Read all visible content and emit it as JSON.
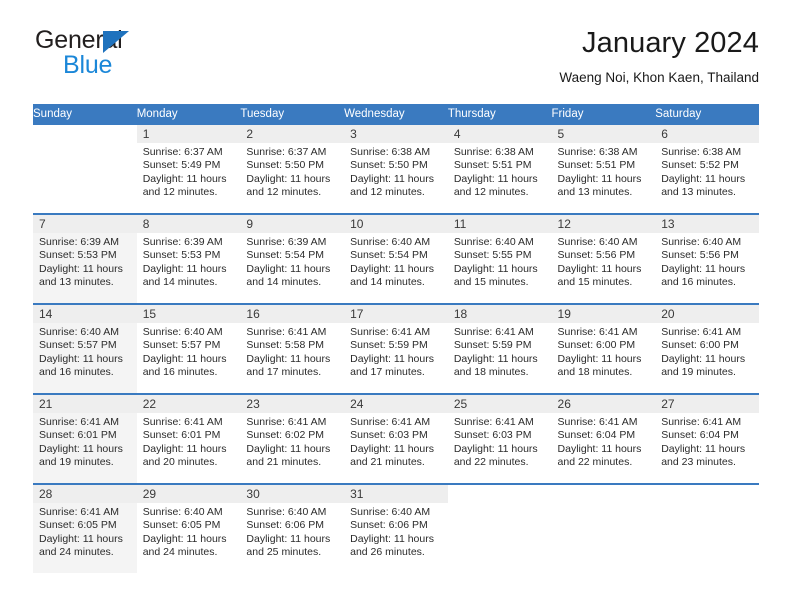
{
  "brand": {
    "name_part1": "General",
    "name_part2": "Blue",
    "accent_color": "#1b87d8",
    "triangle_color": "#1f72bd"
  },
  "header": {
    "title": "January 2024",
    "subtitle": "Waeng Noi, Khon Kaen, Thailand"
  },
  "calendar": {
    "header_bg": "#3a7ac0",
    "header_text_color": "#ffffff",
    "weekday_headers": [
      "Sunday",
      "Monday",
      "Tuesday",
      "Wednesday",
      "Thursday",
      "Friday",
      "Saturday"
    ],
    "weeks": [
      [
        {
          "date": "",
          "sunrise": "",
          "sunset": "",
          "daylight_line1": "",
          "daylight_line2": ""
        },
        {
          "date": "1",
          "sunrise": "Sunrise: 6:37 AM",
          "sunset": "Sunset: 5:49 PM",
          "daylight_line1": "Daylight: 11 hours",
          "daylight_line2": "and 12 minutes."
        },
        {
          "date": "2",
          "sunrise": "Sunrise: 6:37 AM",
          "sunset": "Sunset: 5:50 PM",
          "daylight_line1": "Daylight: 11 hours",
          "daylight_line2": "and 12 minutes."
        },
        {
          "date": "3",
          "sunrise": "Sunrise: 6:38 AM",
          "sunset": "Sunset: 5:50 PM",
          "daylight_line1": "Daylight: 11 hours",
          "daylight_line2": "and 12 minutes."
        },
        {
          "date": "4",
          "sunrise": "Sunrise: 6:38 AM",
          "sunset": "Sunset: 5:51 PM",
          "daylight_line1": "Daylight: 11 hours",
          "daylight_line2": "and 12 minutes."
        },
        {
          "date": "5",
          "sunrise": "Sunrise: 6:38 AM",
          "sunset": "Sunset: 5:51 PM",
          "daylight_line1": "Daylight: 11 hours",
          "daylight_line2": "and 13 minutes."
        },
        {
          "date": "6",
          "sunrise": "Sunrise: 6:38 AM",
          "sunset": "Sunset: 5:52 PM",
          "daylight_line1": "Daylight: 11 hours",
          "daylight_line2": "and 13 minutes."
        }
      ],
      [
        {
          "date": "7",
          "sunrise": "Sunrise: 6:39 AM",
          "sunset": "Sunset: 5:53 PM",
          "daylight_line1": "Daylight: 11 hours",
          "daylight_line2": "and 13 minutes."
        },
        {
          "date": "8",
          "sunrise": "Sunrise: 6:39 AM",
          "sunset": "Sunset: 5:53 PM",
          "daylight_line1": "Daylight: 11 hours",
          "daylight_line2": "and 14 minutes."
        },
        {
          "date": "9",
          "sunrise": "Sunrise: 6:39 AM",
          "sunset": "Sunset: 5:54 PM",
          "daylight_line1": "Daylight: 11 hours",
          "daylight_line2": "and 14 minutes."
        },
        {
          "date": "10",
          "sunrise": "Sunrise: 6:40 AM",
          "sunset": "Sunset: 5:54 PM",
          "daylight_line1": "Daylight: 11 hours",
          "daylight_line2": "and 14 minutes."
        },
        {
          "date": "11",
          "sunrise": "Sunrise: 6:40 AM",
          "sunset": "Sunset: 5:55 PM",
          "daylight_line1": "Daylight: 11 hours",
          "daylight_line2": "and 15 minutes."
        },
        {
          "date": "12",
          "sunrise": "Sunrise: 6:40 AM",
          "sunset": "Sunset: 5:56 PM",
          "daylight_line1": "Daylight: 11 hours",
          "daylight_line2": "and 15 minutes."
        },
        {
          "date": "13",
          "sunrise": "Sunrise: 6:40 AM",
          "sunset": "Sunset: 5:56 PM",
          "daylight_line1": "Daylight: 11 hours",
          "daylight_line2": "and 16 minutes."
        }
      ],
      [
        {
          "date": "14",
          "sunrise": "Sunrise: 6:40 AM",
          "sunset": "Sunset: 5:57 PM",
          "daylight_line1": "Daylight: 11 hours",
          "daylight_line2": "and 16 minutes."
        },
        {
          "date": "15",
          "sunrise": "Sunrise: 6:40 AM",
          "sunset": "Sunset: 5:57 PM",
          "daylight_line1": "Daylight: 11 hours",
          "daylight_line2": "and 16 minutes."
        },
        {
          "date": "16",
          "sunrise": "Sunrise: 6:41 AM",
          "sunset": "Sunset: 5:58 PM",
          "daylight_line1": "Daylight: 11 hours",
          "daylight_line2": "and 17 minutes."
        },
        {
          "date": "17",
          "sunrise": "Sunrise: 6:41 AM",
          "sunset": "Sunset: 5:59 PM",
          "daylight_line1": "Daylight: 11 hours",
          "daylight_line2": "and 17 minutes."
        },
        {
          "date": "18",
          "sunrise": "Sunrise: 6:41 AM",
          "sunset": "Sunset: 5:59 PM",
          "daylight_line1": "Daylight: 11 hours",
          "daylight_line2": "and 18 minutes."
        },
        {
          "date": "19",
          "sunrise": "Sunrise: 6:41 AM",
          "sunset": "Sunset: 6:00 PM",
          "daylight_line1": "Daylight: 11 hours",
          "daylight_line2": "and 18 minutes."
        },
        {
          "date": "20",
          "sunrise": "Sunrise: 6:41 AM",
          "sunset": "Sunset: 6:00 PM",
          "daylight_line1": "Daylight: 11 hours",
          "daylight_line2": "and 19 minutes."
        }
      ],
      [
        {
          "date": "21",
          "sunrise": "Sunrise: 6:41 AM",
          "sunset": "Sunset: 6:01 PM",
          "daylight_line1": "Daylight: 11 hours",
          "daylight_line2": "and 19 minutes."
        },
        {
          "date": "22",
          "sunrise": "Sunrise: 6:41 AM",
          "sunset": "Sunset: 6:01 PM",
          "daylight_line1": "Daylight: 11 hours",
          "daylight_line2": "and 20 minutes."
        },
        {
          "date": "23",
          "sunrise": "Sunrise: 6:41 AM",
          "sunset": "Sunset: 6:02 PM",
          "daylight_line1": "Daylight: 11 hours",
          "daylight_line2": "and 21 minutes."
        },
        {
          "date": "24",
          "sunrise": "Sunrise: 6:41 AM",
          "sunset": "Sunset: 6:03 PM",
          "daylight_line1": "Daylight: 11 hours",
          "daylight_line2": "and 21 minutes."
        },
        {
          "date": "25",
          "sunrise": "Sunrise: 6:41 AM",
          "sunset": "Sunset: 6:03 PM",
          "daylight_line1": "Daylight: 11 hours",
          "daylight_line2": "and 22 minutes."
        },
        {
          "date": "26",
          "sunrise": "Sunrise: 6:41 AM",
          "sunset": "Sunset: 6:04 PM",
          "daylight_line1": "Daylight: 11 hours",
          "daylight_line2": "and 22 minutes."
        },
        {
          "date": "27",
          "sunrise": "Sunrise: 6:41 AM",
          "sunset": "Sunset: 6:04 PM",
          "daylight_line1": "Daylight: 11 hours",
          "daylight_line2": "and 23 minutes."
        }
      ],
      [
        {
          "date": "28",
          "sunrise": "Sunrise: 6:41 AM",
          "sunset": "Sunset: 6:05 PM",
          "daylight_line1": "Daylight: 11 hours",
          "daylight_line2": "and 24 minutes."
        },
        {
          "date": "29",
          "sunrise": "Sunrise: 6:40 AM",
          "sunset": "Sunset: 6:05 PM",
          "daylight_line1": "Daylight: 11 hours",
          "daylight_line2": "and 24 minutes."
        },
        {
          "date": "30",
          "sunrise": "Sunrise: 6:40 AM",
          "sunset": "Sunset: 6:06 PM",
          "daylight_line1": "Daylight: 11 hours",
          "daylight_line2": "and 25 minutes."
        },
        {
          "date": "31",
          "sunrise": "Sunrise: 6:40 AM",
          "sunset": "Sunset: 6:06 PM",
          "daylight_line1": "Daylight: 11 hours",
          "daylight_line2": "and 26 minutes."
        },
        {
          "date": "",
          "sunrise": "",
          "sunset": "",
          "daylight_line1": "",
          "daylight_line2": ""
        },
        {
          "date": "",
          "sunrise": "",
          "sunset": "",
          "daylight_line1": "",
          "daylight_line2": ""
        },
        {
          "date": "",
          "sunrise": "",
          "sunset": "",
          "daylight_line1": "",
          "daylight_line2": ""
        }
      ]
    ]
  }
}
